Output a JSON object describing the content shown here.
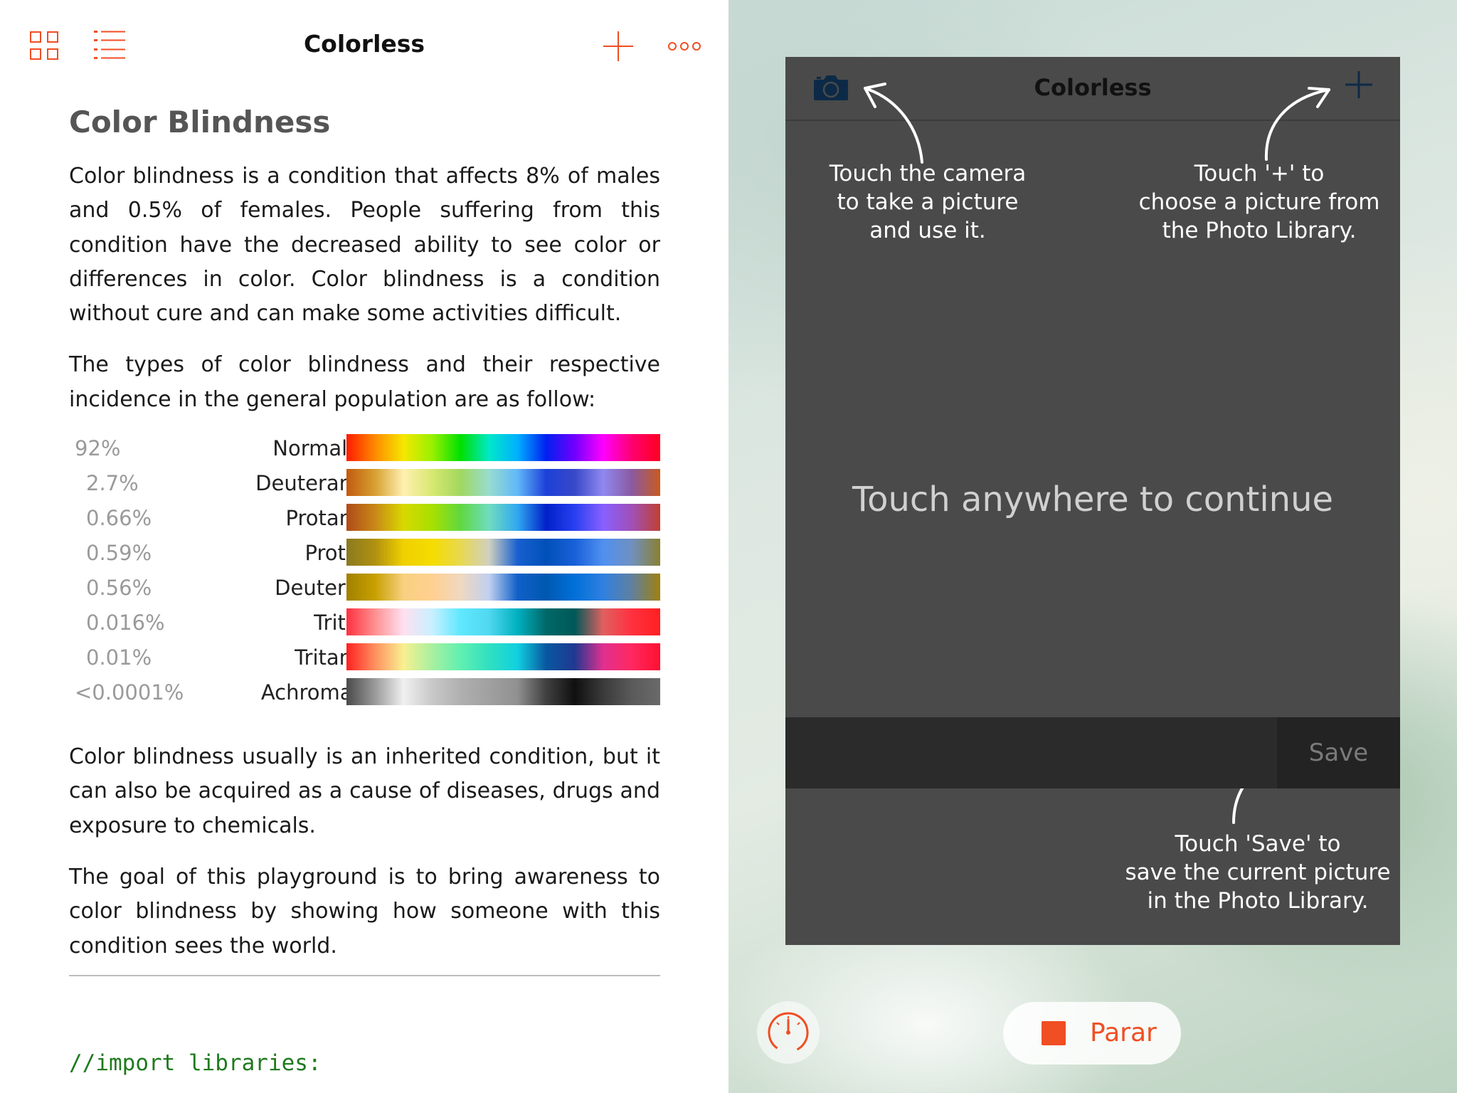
{
  "left_pane": {
    "toolbar": {
      "grid_icon": "grid-icon",
      "list_icon": "list-icon",
      "add_icon": "plus-icon",
      "more_icon": "more-icon",
      "title": "Colorless"
    },
    "document": {
      "heading": "Color Blindness",
      "paragraphs": [
        "Color blindness is a condition that affects 8% of males and 0.5% of females. People suffering from this condition have the decreased ability to see color or differences in color. Color blindness is a condition without cure and can make some activities difficult.",
        "The types of color blindness and their respective incidence in the general population are as follow:",
        "Color blindness usually is an inherited condition, but it can also be acquired as a cause of diseases, drugs and exposure to chemicals.",
        "The goal of this playground is to bring awareness to color blindness by showing how someone with this condition sees the world."
      ],
      "types": [
        {
          "percent": "92%",
          "name": "Normal Vision",
          "colors": [
            "#ff1a00",
            "#ff8a00",
            "#f5e700",
            "#9af000",
            "#00e000",
            "#00e8c8",
            "#00b0ff",
            "#0020f0",
            "#7000ff",
            "#ff00ff",
            "#ff0070",
            "#ff0020"
          ]
        },
        {
          "percent": "2.7%",
          "name": "Deuteranomaly",
          "colors": [
            "#c25a10",
            "#d7a030",
            "#fff0b0",
            "#d8e870",
            "#a0d860",
            "#98dcd0",
            "#60b8f8",
            "#1c40d8",
            "#3848c8",
            "#9088f0",
            "#8a5aa0",
            "#c85a20"
          ]
        },
        {
          "percent": "0.66%",
          "name": "Protanomaly",
          "colors": [
            "#b04a18",
            "#c88818",
            "#d8d800",
            "#a8e000",
            "#60d840",
            "#70dcc0",
            "#30a8f0",
            "#0020c8",
            "#2840f0",
            "#8860ff",
            "#a050b8",
            "#c04030"
          ]
        },
        {
          "percent": "0.59%",
          "name": "Protanopia",
          "colors": [
            "#8a7a20",
            "#b09010",
            "#f0d000",
            "#f5dc00",
            "#e8d850",
            "#d0d0c0",
            "#1860d0",
            "#0050b8",
            "#1860d8",
            "#5090f0",
            "#7090c0",
            "#8a8030"
          ]
        },
        {
          "percent": "0.56%",
          "name": "Deuteranopia",
          "colors": [
            "#a08000",
            "#c8a000",
            "#f8d080",
            "#ffd090",
            "#f0d8c0",
            "#c0d0f0",
            "#1060c8",
            "#0058b0",
            "#0070d8",
            "#3080e0",
            "#6080a0",
            "#a08010"
          ]
        },
        {
          "percent": "0.016%",
          "name": "Tritanopia",
          "colors": [
            "#ff3040",
            "#ff9090",
            "#ffe0f0",
            "#c8f0ff",
            "#60e8ff",
            "#50d8f0",
            "#00b0c0",
            "#006868",
            "#005858",
            "#e06060",
            "#ff3040",
            "#ff2020"
          ]
        },
        {
          "percent": "0.01%",
          "name": "Tritanomaly",
          "colors": [
            "#ff2020",
            "#ff9060",
            "#f8f090",
            "#a8f0a0",
            "#60f0b0",
            "#30e0c0",
            "#10d0e0",
            "#0858a0",
            "#203890",
            "#e03090",
            "#ff2860",
            "#ff1030"
          ]
        },
        {
          "percent": "<0.0001%",
          "name": "Achromatopsia",
          "colors": [
            "#4a4a4a",
            "#9a9a9a",
            "#f0f0f0",
            "#c8c8c8",
            "#b0b0b0",
            "#a0a0a0",
            "#909090",
            "#404040",
            "#101010",
            "#3a3a3a",
            "#5a5a5a",
            "#6a6a6a"
          ]
        }
      ]
    },
    "code": {
      "comment": "//import libraries:"
    }
  },
  "live_view": {
    "nav": {
      "title": "Colorless",
      "camera_icon": "camera-icon",
      "add_icon": "plus-icon"
    },
    "hints": {
      "camera": [
        "Touch the camera",
        "to take a picture",
        "and use it."
      ],
      "plus": [
        "Touch '+' to",
        "choose a picture from",
        "the Photo Library."
      ],
      "save": [
        "Touch 'Save' to",
        "save the current picture",
        "in the Photo Library."
      ]
    },
    "continue_text": "Touch anywhere to continue",
    "save_label": "Save",
    "controls": {
      "meter_icon": "speedometer-icon",
      "stop_label": "Parar",
      "accent": "#f04e23"
    }
  }
}
